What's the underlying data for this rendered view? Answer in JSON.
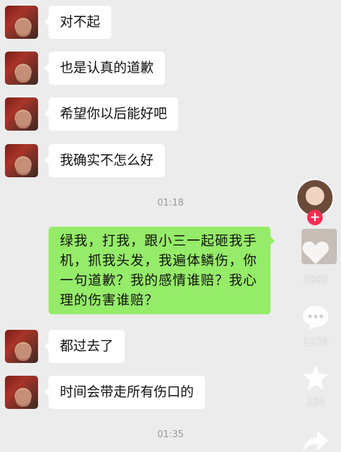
{
  "messages_top": [
    {
      "text": "对不起"
    },
    {
      "text": "也是认真的道歉"
    },
    {
      "text": "希望你以后能好吧"
    },
    {
      "text": "我确实不怎么好"
    }
  ],
  "timestamp_1": "01:18",
  "sent_message": "绿我，打我，跟小三一起砸我手机，抓我头发，我遍体鳞伤，你一句道歉？我的感情谁赔？我心理的伤害谁赔？",
  "messages_bottom": [
    {
      "text": "都过去了"
    },
    {
      "text": "时间会带走所有伤口的"
    }
  ],
  "timestamp_2": "01:35",
  "overlay": {
    "follow_symbol": "+",
    "like_count": "3085",
    "comment_count": "1278",
    "favorite_count": "234"
  },
  "colors": {
    "chat_background": "#ececec",
    "received_bubble": "#ffffff",
    "sent_bubble": "#95ec69",
    "follow_button": "#fe2c55"
  },
  "icons": [
    "heart-icon",
    "comment-icon",
    "star-icon",
    "share-icon"
  ]
}
